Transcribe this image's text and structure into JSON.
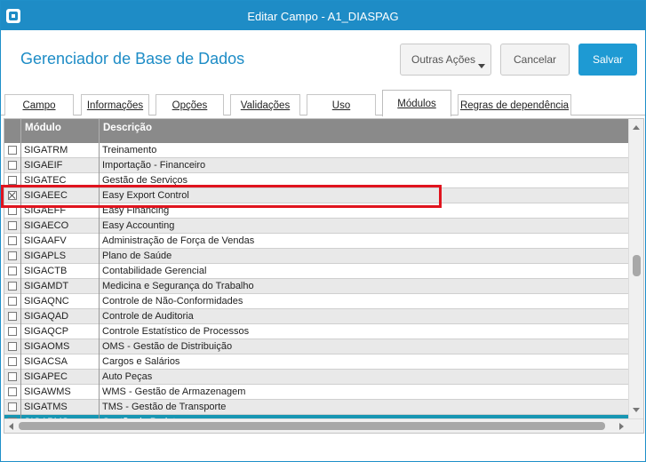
{
  "window": {
    "title": "Editar Campo - A1_DIASPAG"
  },
  "header": {
    "app_title": "Gerenciador de Base de Dados",
    "more_actions_label": "Outras Ações",
    "cancel_label": "Cancelar",
    "save_label": "Salvar"
  },
  "tabs": [
    {
      "label": "Campo",
      "active": false
    },
    {
      "label": "Informações",
      "active": false
    },
    {
      "label": "Opções",
      "active": false
    },
    {
      "label": "Validações",
      "active": false
    },
    {
      "label": "Uso",
      "active": false
    },
    {
      "label": "Módulos",
      "active": true
    },
    {
      "label": "Regras de dependência",
      "active": false
    }
  ],
  "grid": {
    "columns": [
      "Módulo",
      "Descrição"
    ],
    "rows": [
      {
        "checked": false,
        "module": "SIGATRM",
        "description": "Treinamento",
        "selected": false
      },
      {
        "checked": false,
        "module": "SIGAEIF",
        "description": "Importação - Financeiro",
        "selected": false
      },
      {
        "checked": false,
        "module": "SIGATEC",
        "description": "Gestão de Serviços",
        "selected": false
      },
      {
        "checked": true,
        "module": "SIGAEEC",
        "description": "Easy Export Control",
        "selected": false
      },
      {
        "checked": false,
        "module": "SIGAEFF",
        "description": "Easy Financing",
        "selected": false
      },
      {
        "checked": false,
        "module": "SIGAECO",
        "description": "Easy Accounting",
        "selected": false
      },
      {
        "checked": false,
        "module": "SIGAAFV",
        "description": "Administração de Força de Vendas",
        "selected": false
      },
      {
        "checked": false,
        "module": "SIGAPLS",
        "description": "Plano de Saúde",
        "selected": false
      },
      {
        "checked": false,
        "module": "SIGACTB",
        "description": "Contabilidade Gerencial",
        "selected": false
      },
      {
        "checked": false,
        "module": "SIGAMDT",
        "description": "Medicina e Segurança do Trabalho",
        "selected": false
      },
      {
        "checked": false,
        "module": "SIGAQNC",
        "description": "Controle de Não-Conformidades",
        "selected": false
      },
      {
        "checked": false,
        "module": "SIGAQAD",
        "description": "Controle de Auditoria",
        "selected": false
      },
      {
        "checked": false,
        "module": "SIGAQCP",
        "description": "Controle Estatístico de Processos",
        "selected": false
      },
      {
        "checked": false,
        "module": "SIGAOMS",
        "description": "OMS - Gestão de Distribuição",
        "selected": false
      },
      {
        "checked": false,
        "module": "SIGACSA",
        "description": "Cargos e Salários",
        "selected": false
      },
      {
        "checked": false,
        "module": "SIGAPEC",
        "description": "Auto Peças",
        "selected": false
      },
      {
        "checked": false,
        "module": "SIGAWMS",
        "description": "WMS - Gestão de Armazenagem",
        "selected": false
      },
      {
        "checked": false,
        "module": "SIGATMS",
        "description": "TMS - Gestão de Transporte",
        "selected": false
      },
      {
        "checked": false,
        "module": "SIGAPMS",
        "description": "Gestão de Projetos",
        "selected": true
      }
    ]
  },
  "icons": {
    "app": "app-icon",
    "dropdown": "chevron-down-icon"
  },
  "colors": {
    "accent": "#1e8cc6",
    "save_button": "#1e9ad3",
    "selected_row": "#1796b3",
    "highlight": "#e0141e",
    "grid_header": "#8a8a8a"
  }
}
